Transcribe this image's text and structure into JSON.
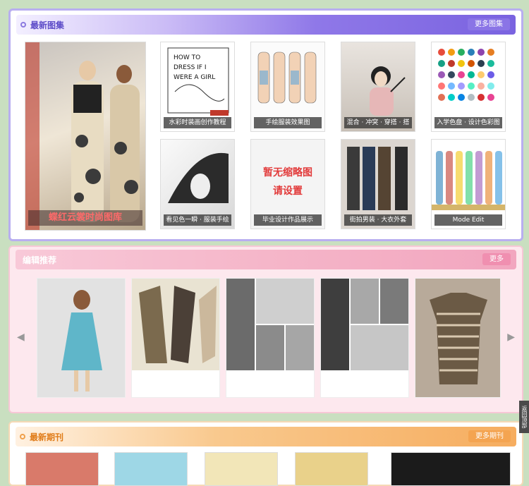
{
  "sections": {
    "new_atlas": {
      "title": "最新图集",
      "more": "更多图集",
      "feature_caption": "蝶红云裳时尚图库",
      "items": [
        {
          "caption": "水彩时装画创作教程"
        },
        {
          "caption": "手绘服装效果图"
        },
        {
          "caption": "混合 · 冲突 · 穿搭 · 搭"
        },
        {
          "caption": "入学色盘 · 设计色彩图"
        },
        {
          "caption": "看见色一瞬 · 服装手绘"
        },
        {
          "caption": "毕业设计作品展示"
        },
        {
          "caption": "街拍男装 · 大衣外套"
        },
        {
          "caption": "Mode Edit"
        }
      ],
      "placeholder_line1": "暂无缩略图",
      "placeholder_line2": "请设置"
    },
    "recommend": {
      "title": "编辑推荐",
      "more": "更多"
    },
    "magazines": {
      "title": "最新期刊",
      "more": "更多期刊"
    }
  },
  "side_tab": "返回顶部",
  "colors": {
    "purple": "#7a63e0",
    "pink": "#f2a6bf",
    "orange": "#f6ad5f"
  }
}
